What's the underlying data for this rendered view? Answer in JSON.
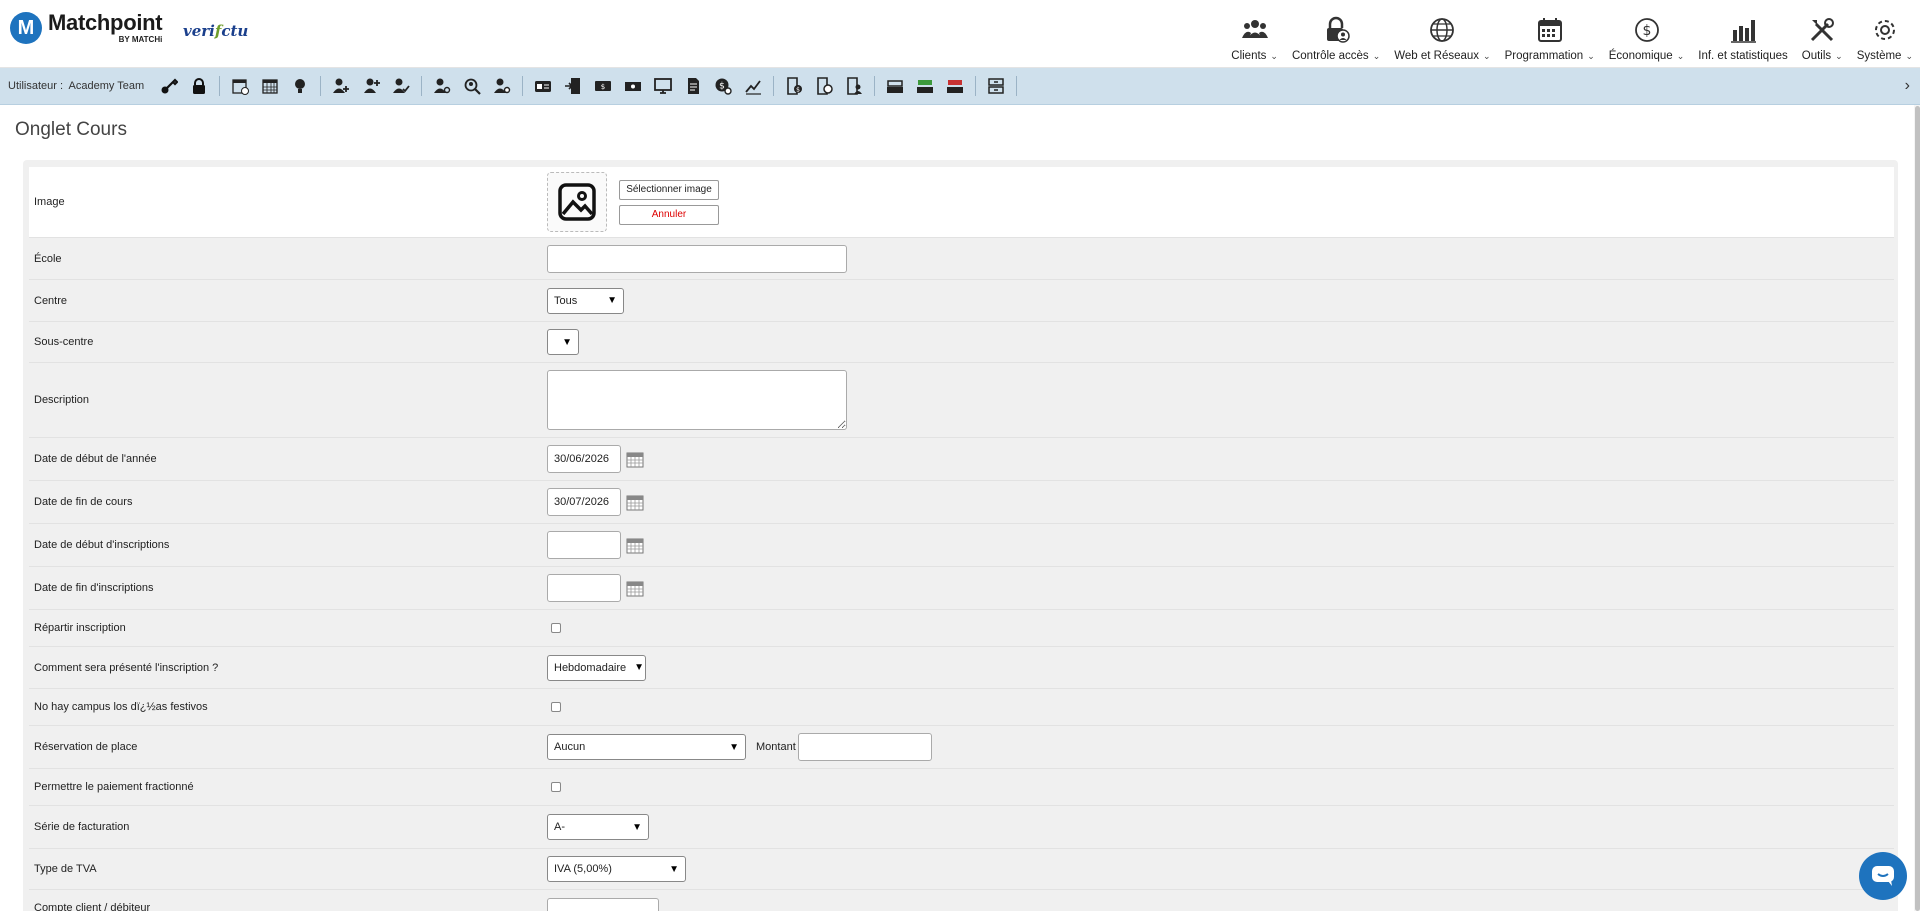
{
  "header": {
    "brand": "Matchpoint",
    "brand_letter": "M",
    "brand_by": "BY MATCHi",
    "verifactu_pre": "veri",
    "verifactu_mark": "f",
    "verifactu_post": "ctu",
    "menu": [
      {
        "label": "Clients",
        "icon": "users-icon",
        "dropdown": true
      },
      {
        "label": "Contrôle accès",
        "icon": "lock-user-icon",
        "dropdown": true
      },
      {
        "label": "Web et Réseaux",
        "icon": "globe-icon",
        "dropdown": true
      },
      {
        "label": "Programmation",
        "icon": "calendar-icon",
        "dropdown": true
      },
      {
        "label": "Économique",
        "icon": "dollar-icon",
        "dropdown": true
      },
      {
        "label": "Inf. et statistiques",
        "icon": "bar-chart-icon",
        "dropdown": false
      },
      {
        "label": "Outils",
        "icon": "tools-icon",
        "dropdown": true
      },
      {
        "label": "Système",
        "icon": "gear-icon",
        "dropdown": true
      }
    ]
  },
  "toolbar": {
    "user_prefix": "Utilisateur :",
    "user_name": "Academy Team"
  },
  "page": {
    "title": "Onglet Cours"
  },
  "form": {
    "image_label": "Image",
    "select_image": "Sélectionner image",
    "cancel": "Annuler",
    "ecole_label": "École",
    "ecole_value": "",
    "centre_label": "Centre",
    "centre_value": "Tous",
    "sous_centre_label": "Sous-centre",
    "sous_centre_value": "",
    "description_label": "Description",
    "date_debut_annee_label": "Date de début de l'année",
    "date_debut_annee_value": "30/06/2026",
    "date_fin_cours_label": "Date de fin de cours",
    "date_fin_cours_value": "30/07/2026",
    "date_debut_inscr_label": "Date de début d'inscriptions",
    "date_debut_inscr_value": "",
    "date_fin_inscr_label": "Date de fin d'inscriptions",
    "date_fin_inscr_value": "",
    "repartir_label": "Répartir inscription",
    "presentation_label": "Comment sera présenté l'inscription ?",
    "presentation_value": "Hebdomadaire",
    "festivos_label": "No hay campus los dï¿½as festivos",
    "reservation_label": "Réservation de place",
    "reservation_value": "Aucun",
    "montant_label": "Montant",
    "montant_value": "",
    "paiement_label": "Permettre le paiement fractionné",
    "serie_label": "Série de facturation",
    "serie_value": "A-",
    "tva_label": "Type de TVA",
    "tva_value": "IVA (5,00%)",
    "compte_label": "Compte client / débiteur"
  }
}
